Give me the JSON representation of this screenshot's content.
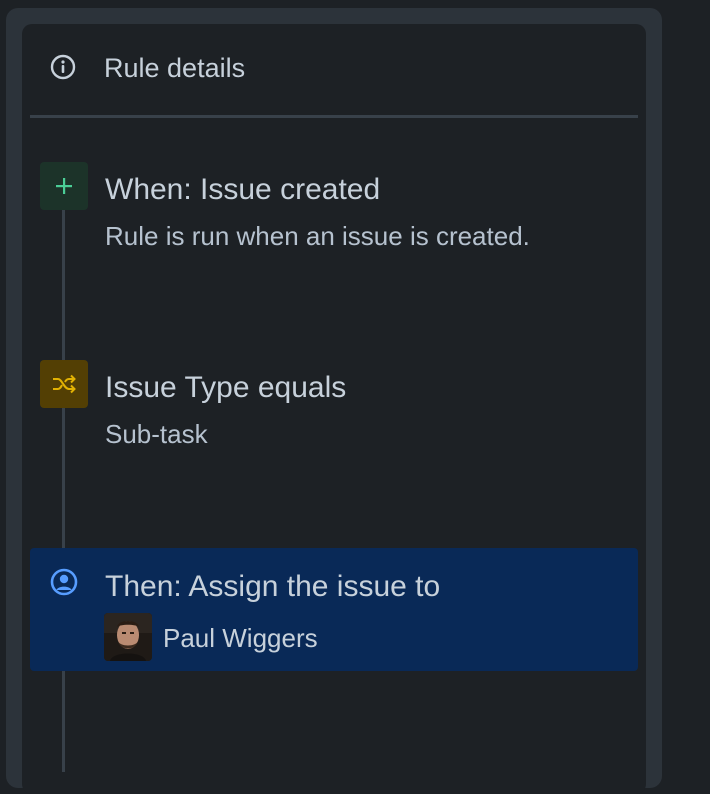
{
  "header": {
    "title": "Rule details",
    "icon": "info-icon"
  },
  "steps": [
    {
      "kind": "trigger",
      "icon": "plus-icon",
      "icon_bg": "#1c3329",
      "icon_color": "#4bce97",
      "title": "When: Issue created",
      "description": "Rule is run when an issue is created."
    },
    {
      "kind": "condition",
      "icon": "shuffle-icon",
      "icon_bg": "#533f04",
      "icon_color": "#e2b203",
      "title": "Issue Type equals",
      "description": "Sub-task"
    },
    {
      "kind": "action",
      "icon": "user-circle-icon",
      "icon_color": "#579dff",
      "highlight_bg": "#092957",
      "title": "Then: Assign the issue to",
      "assignee": {
        "name": "Paul Wiggers",
        "avatar": "user-avatar-photo"
      }
    }
  ]
}
